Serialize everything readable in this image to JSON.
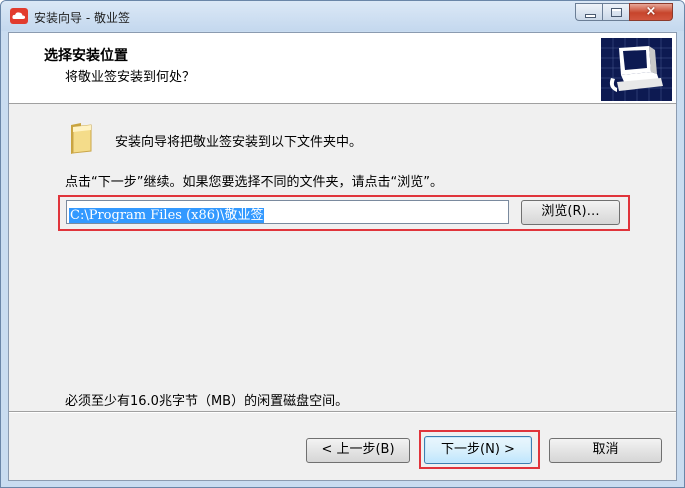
{
  "window": {
    "title": "安装向导 - 敬业签",
    "close_glyph": "×"
  },
  "header": {
    "title": "选择安装位置",
    "subtitle": "将敬业签安装到何处？"
  },
  "body": {
    "intro": "安装向导将把敬业签安装到以下文件夹中。",
    "instruction": "点击“下一步”继续。如果您要选择不同的文件夹，请点击“浏览”。",
    "install_path": "C:\\Program Files (x86)\\敬业签",
    "browse_label": "浏览(R)…",
    "space_required": "必须至少有16.0兆字节（MB）的闲置磁盘空间。"
  },
  "buttons": {
    "back_label": "< 上一步(B)",
    "next_label": "下一步(N) >",
    "cancel_label": "取消"
  },
  "colors": {
    "highlight": "#e0343b",
    "selection": "#3399ff",
    "header_image_bg": "#0d1a52"
  },
  "icons": {
    "app": "cloud-logo-icon",
    "folder": "folder-icon",
    "header": "computer-install-icon"
  }
}
